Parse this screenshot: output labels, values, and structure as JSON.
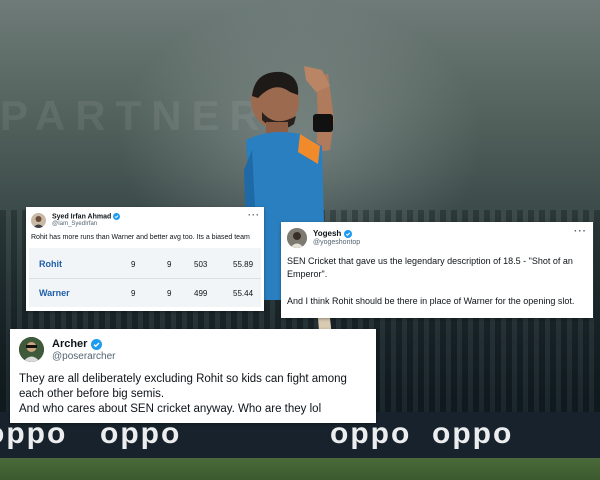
{
  "background": {
    "ad_text": "oppo",
    "board_text": "PARTNER"
  },
  "tweets": [
    {
      "id": "syed",
      "name": "Syed Irfan Ahmad",
      "handle": "@Iam_SyedIrfan",
      "verified": true,
      "text": "Rohit has more runs than Warner and better avg too. Its a biased team",
      "more_icon": "more-horizontal-icon",
      "stats": [
        {
          "player": "Rohit",
          "col1": "9",
          "col2": "9",
          "runs": "503",
          "avg": "55.89"
        },
        {
          "player": "Warner",
          "col1": "9",
          "col2": "9",
          "runs": "499",
          "avg": "55.44"
        }
      ]
    },
    {
      "id": "yogesh",
      "name": "Yogesh",
      "handle": "@yogeshontop",
      "verified": true,
      "text_1": "SEN Cricket that gave us the legendary description of 18.5 - \"Shot of an Emperor\".",
      "text_2": "And I think Rohit should be there in place of Warner for the opening slot.",
      "more_icon": "more-horizontal-icon"
    },
    {
      "id": "archer",
      "name": "Archer",
      "handle": "@poserarcher",
      "verified": true,
      "text_1": "They are all deliberately excluding Rohit so kids can fight among each other before big semis.",
      "text_2": "And who cares about SEN cricket anyway. Who are they lol"
    }
  ],
  "colors": {
    "verified": "#1d9bf0",
    "stat_name": "#1f5fa8",
    "card_bg": "#ffffff"
  }
}
